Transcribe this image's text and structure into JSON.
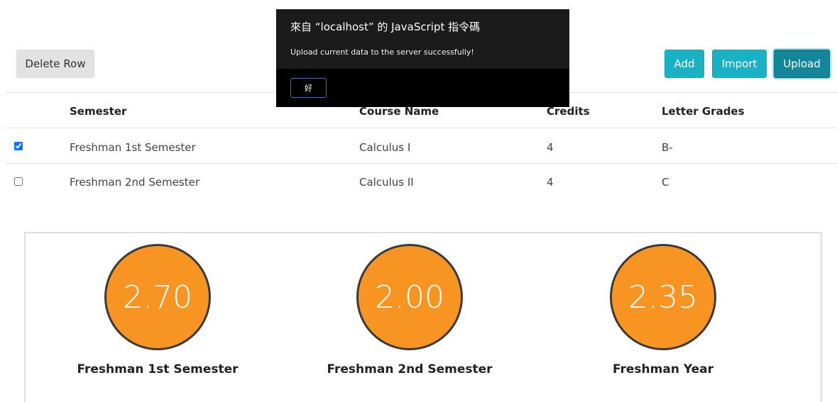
{
  "toolbar": {
    "delete_label": "Delete Row",
    "add_label": "Add",
    "import_label": "Import",
    "upload_label": "Upload"
  },
  "table": {
    "headers": [
      "Semester",
      "Course Name",
      "Credits",
      "Letter Grades"
    ],
    "rows": [
      {
        "checked": true,
        "semester": "Freshman 1st Semester",
        "course": "Calculus I",
        "credits": "4",
        "grade": "B-"
      },
      {
        "checked": false,
        "semester": "Freshman 2nd Semester",
        "course": "Calculus II",
        "credits": "4",
        "grade": "C"
      }
    ]
  },
  "gpa": [
    {
      "value": "2.70",
      "label": "Freshman 1st Semester"
    },
    {
      "value": "2.00",
      "label": "Freshman 2nd Semester"
    },
    {
      "value": "2.35",
      "label": "Freshman Year"
    }
  ],
  "dialog": {
    "title": "來自 “localhost” 的 JavaScript 指令碼",
    "message": "Upload current data to the server successfully!",
    "ok_label": "好"
  },
  "colors": {
    "accent": "#1bb1c4",
    "accent_active": "#138799",
    "gpa_fill": "#f89422",
    "gpa_border": "#3a3a3a"
  }
}
